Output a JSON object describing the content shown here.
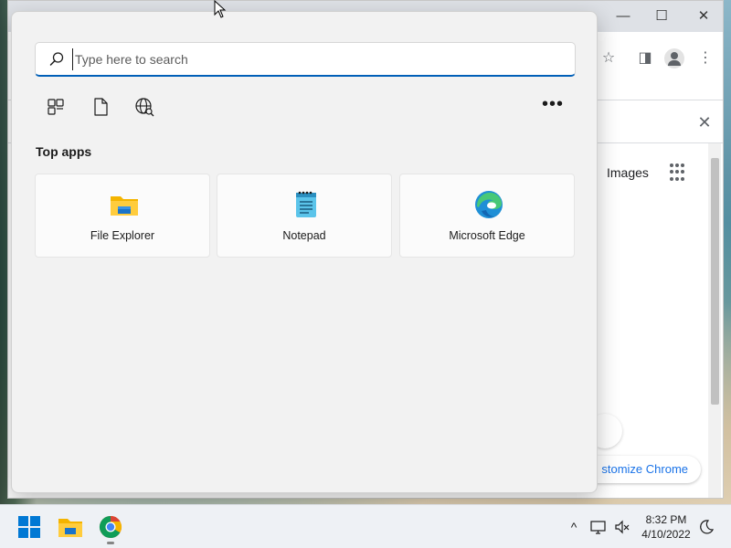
{
  "desktop": {},
  "chrome_window": {
    "images_link": "Images",
    "customize_button": "stomize Chrome",
    "window_controls": {
      "minimize": "—",
      "maximize": "☐",
      "close": "✕"
    },
    "toolbar": {
      "star_icon": "☆",
      "sidepanel_icon": "◨",
      "menu_icon": "⋮"
    },
    "infobar_close": "✕"
  },
  "search_panel": {
    "search": {
      "placeholder": "Type here to search",
      "value": ""
    },
    "more_label": "•••",
    "section_title": "Top apps",
    "apps": [
      {
        "label": "File Explorer",
        "icon": "file-explorer-icon"
      },
      {
        "label": "Notepad",
        "icon": "notepad-icon"
      },
      {
        "label": "Microsoft Edge",
        "icon": "edge-icon"
      }
    ]
  },
  "taskbar": {
    "tray": {
      "chevron": "^",
      "time": "8:32 PM",
      "date": "4/10/2022"
    }
  },
  "colors": {
    "accent": "#005fb8",
    "panel_bg": "#f2f2f2",
    "taskbar_bg": "#eef1f5"
  }
}
